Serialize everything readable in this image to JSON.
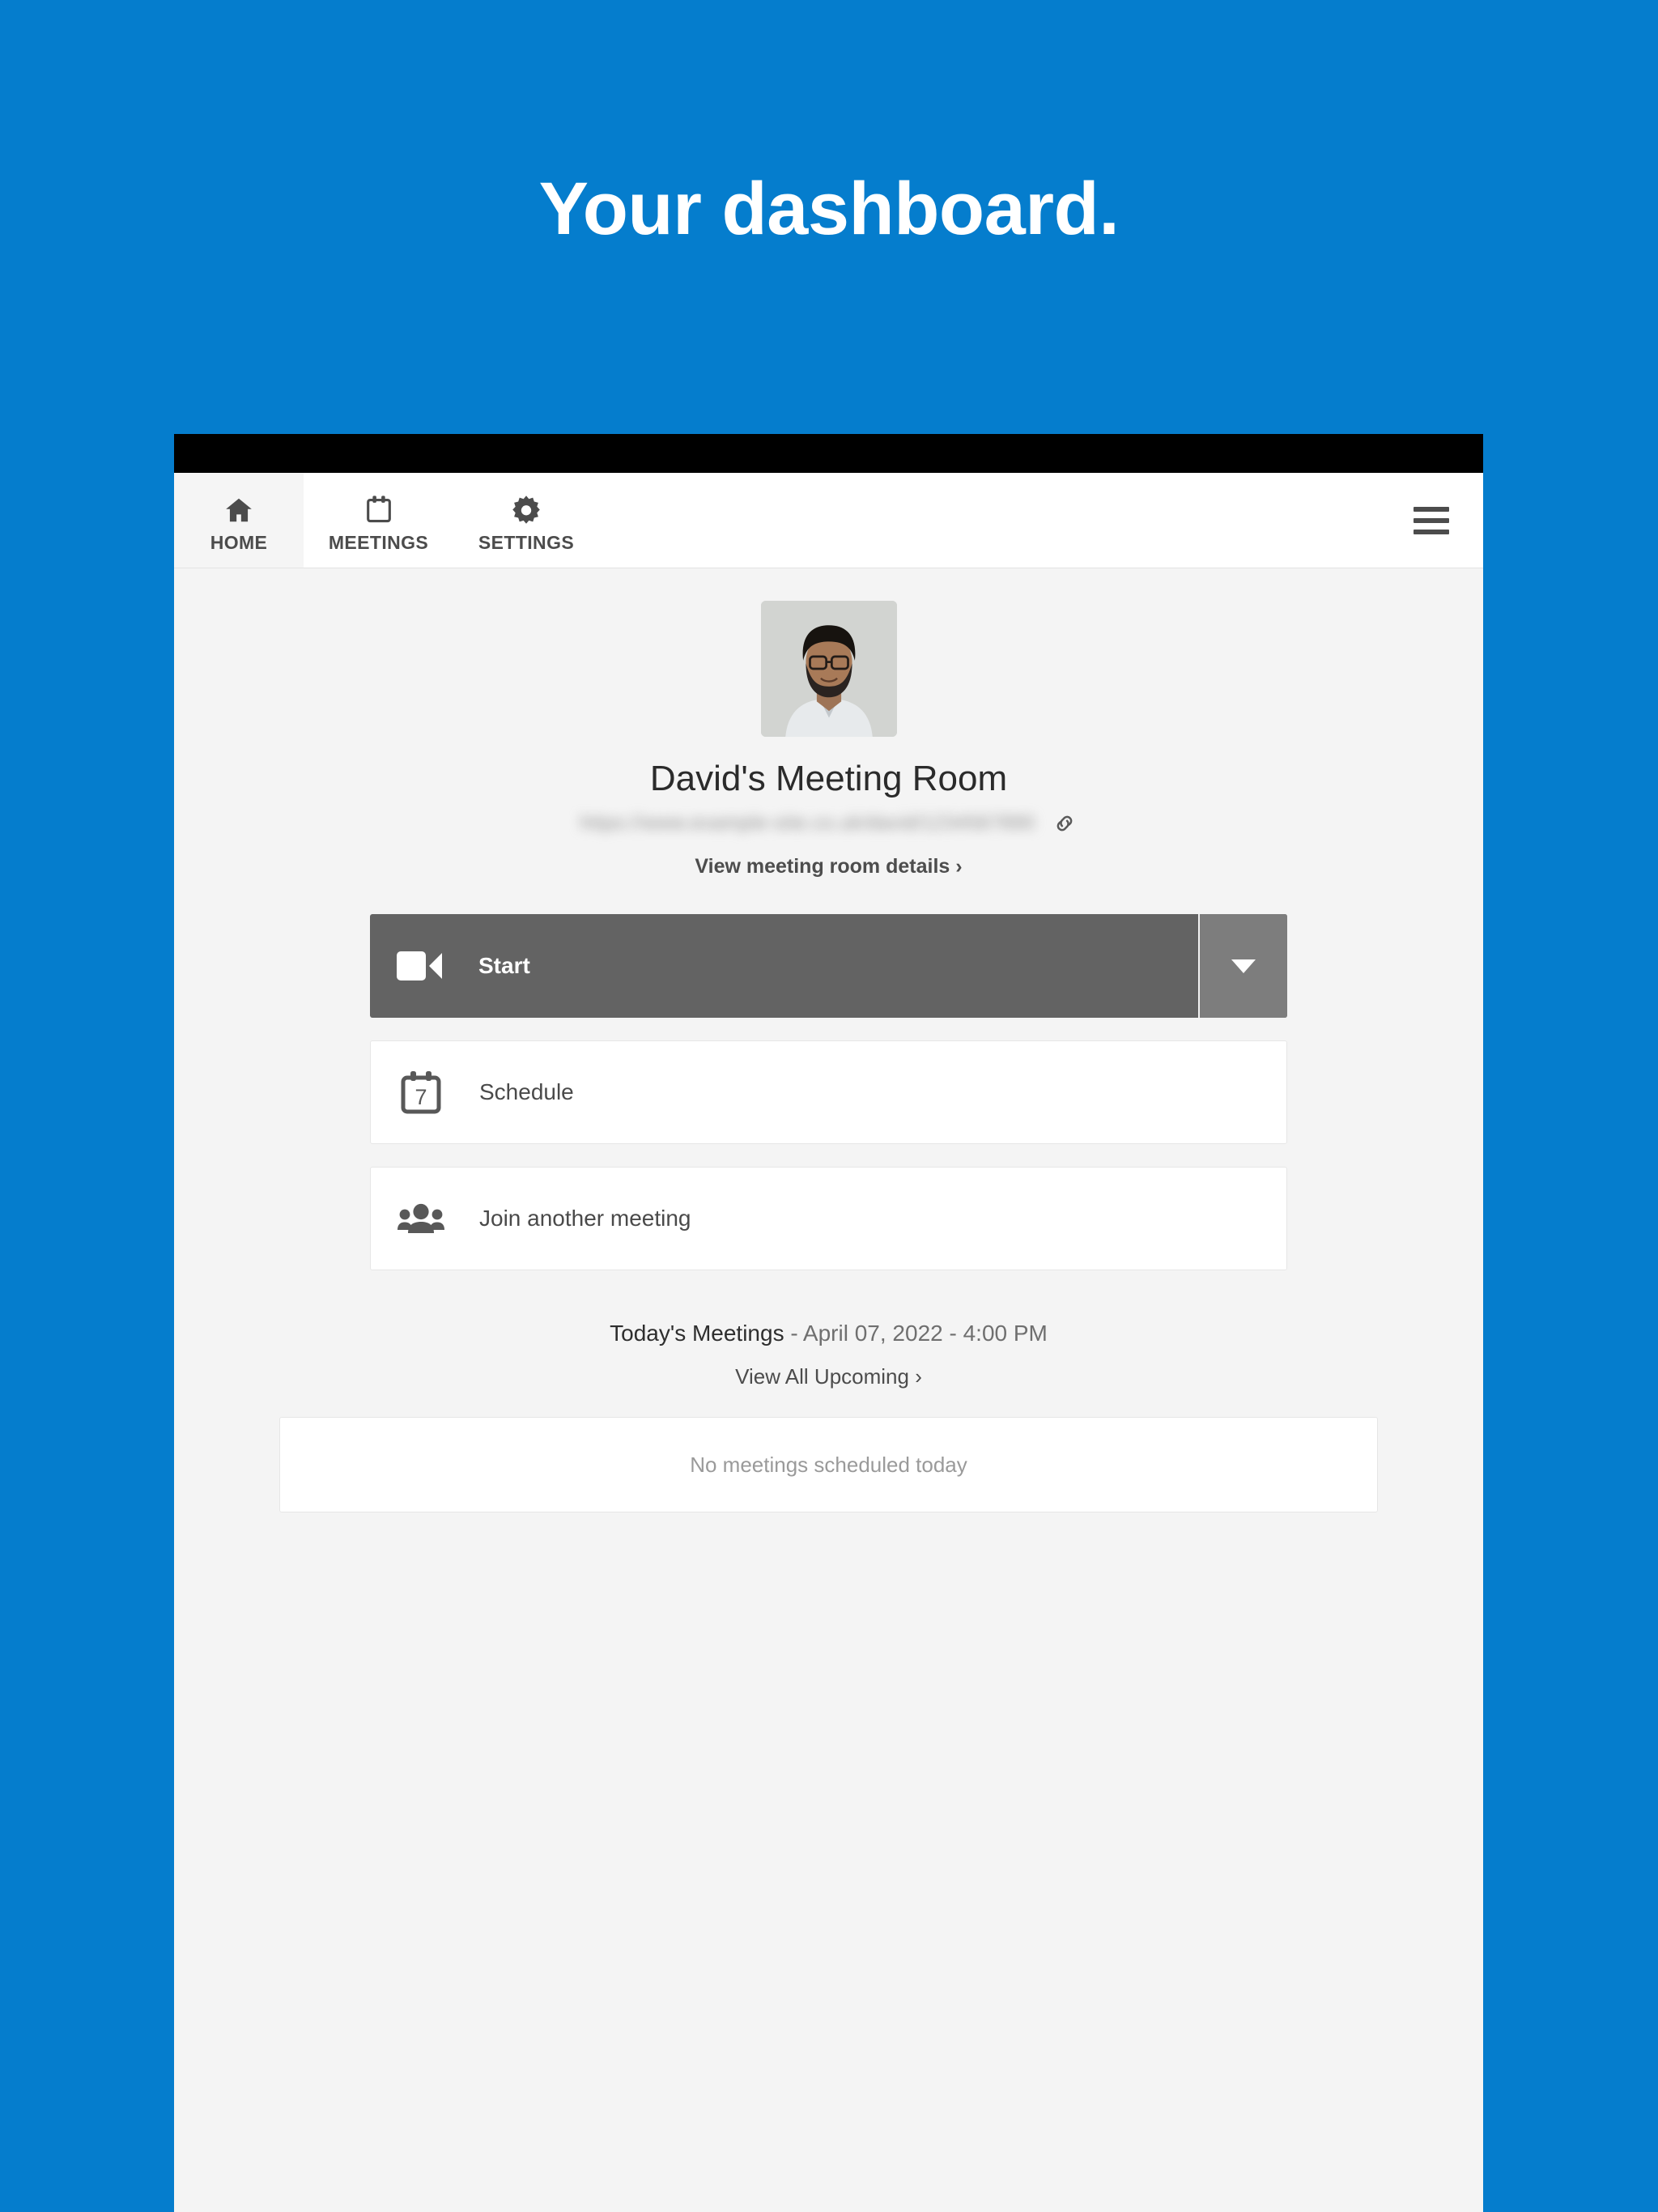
{
  "hero": {
    "headline": "Your dashboard."
  },
  "theme": {
    "brand_blue": "#057dcd",
    "status_bar": "#000000",
    "start_button": "#636363",
    "start_caret": "#7d7d7d",
    "content_bg": "#f4f4f4"
  },
  "navbar": {
    "tabs": [
      {
        "label": "HOME",
        "icon": "home-icon",
        "active": true
      },
      {
        "label": "MEETINGS",
        "icon": "calendar-icon",
        "active": false
      },
      {
        "label": "SETTINGS",
        "icon": "gear-icon",
        "active": false
      }
    ],
    "menu_icon": "hamburger-menu-icon"
  },
  "profile": {
    "avatar_icon": "user-photo-avatar",
    "room_title": "David's Meeting Room",
    "room_url": "https://www.example-site.co.uk/david/1234567890",
    "copy_link_icon": "link-icon",
    "details_link": "View meeting room details  ›"
  },
  "actions": {
    "start": {
      "label": "Start",
      "icon": "video-camera-icon",
      "dropdown_icon": "caret-down-icon"
    },
    "schedule": {
      "label": "Schedule",
      "icon": "calendar-day-7-icon",
      "day_number": "7"
    },
    "join": {
      "label": "Join another meeting",
      "icon": "people-group-icon"
    }
  },
  "today": {
    "title": "Today's Meetings",
    "meta": " - April 07, 2022 - 4:00 PM",
    "upcoming_link": "View All Upcoming ›",
    "empty_message": "No meetings scheduled today"
  }
}
